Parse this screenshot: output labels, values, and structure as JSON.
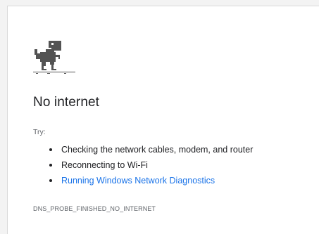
{
  "error_page": {
    "title": "No internet",
    "try_label": "Try:",
    "suggestions": [
      {
        "text": "Checking the network cables, modem, and router",
        "is_link": false
      },
      {
        "text": "Reconnecting to Wi-Fi",
        "is_link": false
      },
      {
        "text": "Running Windows Network Diagnostics",
        "is_link": true
      }
    ],
    "error_code": "DNS_PROBE_FINISHED_NO_INTERNET"
  },
  "icons": {
    "offline": "dinosaur-icon"
  },
  "colors": {
    "link": "#1a73e8",
    "text": "#202124",
    "secondary_text": "#5f6368"
  }
}
